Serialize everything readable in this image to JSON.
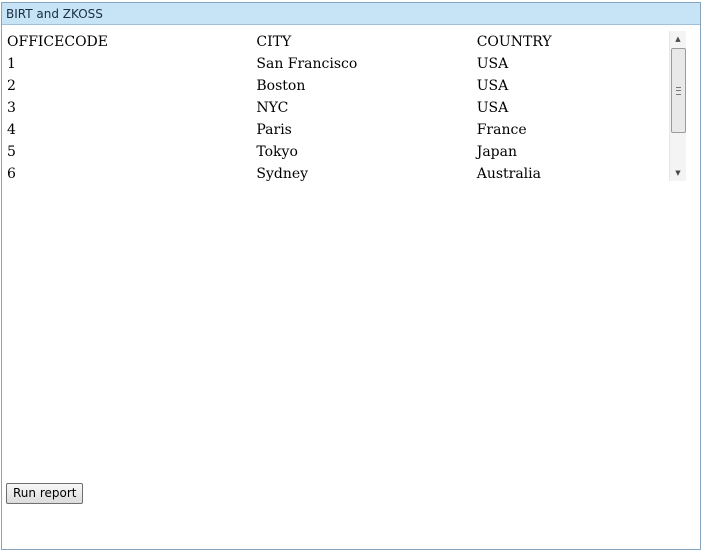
{
  "window": {
    "title": "BIRT and ZKOSS"
  },
  "report": {
    "columns": [
      "OFFICECODE",
      "CITY",
      "COUNTRY"
    ],
    "rows": [
      [
        "1",
        "San Francisco",
        "USA"
      ],
      [
        "2",
        "Boston",
        "USA"
      ],
      [
        "3",
        "NYC",
        "USA"
      ],
      [
        "4",
        "Paris",
        "France"
      ],
      [
        "5",
        "Tokyo",
        "Japan"
      ],
      [
        "6",
        "Sydney",
        "Australia"
      ]
    ]
  },
  "scrollbar": {
    "up_icon": "▲",
    "down_icon": "▼"
  },
  "actions": {
    "run_report_label": "Run report"
  }
}
